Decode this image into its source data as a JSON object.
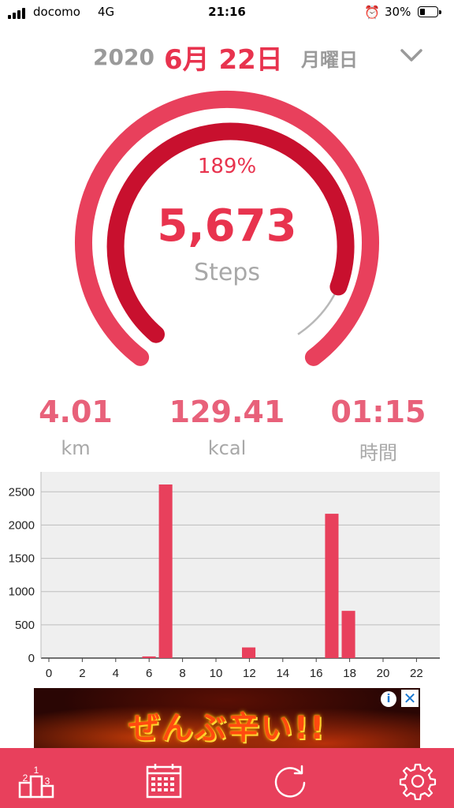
{
  "status_bar": {
    "carrier": "docomo",
    "network": "4G",
    "time": "21:16",
    "battery_percent": "30%",
    "battery_level": 0.3
  },
  "date": {
    "year": "2020",
    "month_day": "6月 22日",
    "weekday": "月曜日"
  },
  "progress": {
    "percent_label": "189%",
    "steps": "5,673",
    "unit": "Steps"
  },
  "stats": [
    {
      "value": "4.01",
      "unit": "km"
    },
    {
      "value": "129.41",
      "unit": "kcal"
    },
    {
      "value": "01:15",
      "unit": "時間"
    }
  ],
  "chart_data": {
    "type": "bar",
    "x": [
      0,
      1,
      2,
      3,
      4,
      5,
      6,
      7,
      8,
      9,
      10,
      11,
      12,
      13,
      14,
      15,
      16,
      17,
      18,
      19,
      20,
      21,
      22,
      23
    ],
    "values": [
      0,
      0,
      0,
      0,
      0,
      0,
      25,
      2610,
      0,
      0,
      0,
      0,
      160,
      0,
      0,
      0,
      0,
      2170,
      710,
      0,
      0,
      0,
      0,
      0
    ],
    "xticks": [
      "0",
      "2",
      "4",
      "6",
      "8",
      "10",
      "12",
      "14",
      "16",
      "18",
      "20",
      "22"
    ],
    "yticks": [
      "0",
      "500",
      "1000",
      "1500",
      "2000",
      "2500"
    ],
    "ylim": [
      0,
      2800
    ],
    "grid": true,
    "color": "#e8405c"
  },
  "ad": {
    "text": "ぜんぶ辛い!!"
  },
  "colors": {
    "accent": "#e8405c",
    "inner_ring": "#c8102e",
    "gray": "#9a9a9a"
  },
  "tabs": [
    {
      "icon": "ranking-icon"
    },
    {
      "icon": "calendar-icon"
    },
    {
      "icon": "refresh-icon"
    },
    {
      "icon": "gear-icon"
    }
  ],
  "ranking_digits": [
    "1",
    "2",
    "3"
  ]
}
